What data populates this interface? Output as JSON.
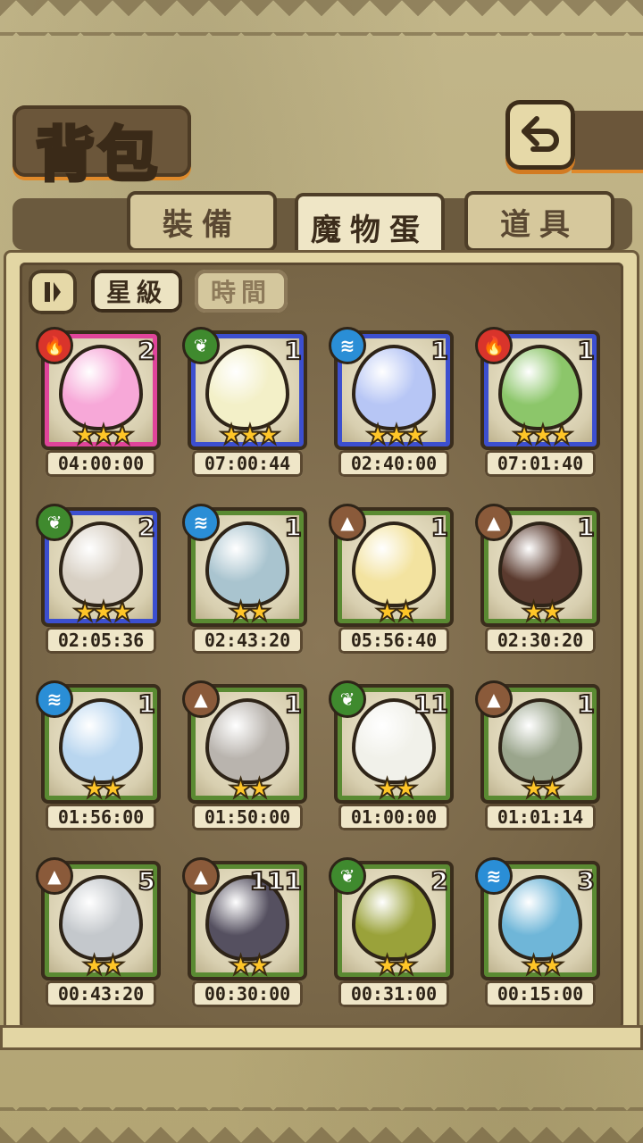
{
  "header": {
    "title": "背包"
  },
  "tabs": [
    {
      "label": "裝備",
      "active": false
    },
    {
      "label": "魔物蛋",
      "active": true
    },
    {
      "label": "道具",
      "active": false
    }
  ],
  "sort": {
    "star_label": "星級",
    "time_label": "時間"
  },
  "colors": {
    "fire": "#d9342b",
    "plant": "#3f8a2e",
    "water": "#2a8ed6",
    "earth": "#8a5a3a",
    "rarity_pink": "#e0449a",
    "rarity_blue": "#3c4fcf",
    "rarity_green": "#5a8a32"
  },
  "eggs": [
    {
      "element": "fire-icon",
      "count": "2",
      "stars": "★★★",
      "timer": "04:00:00",
      "rarity": "pink",
      "egg_color": "#f7a8d8"
    },
    {
      "element": "plant-icon",
      "count": "1",
      "stars": "★★★",
      "timer": "07:00:44",
      "rarity": "blue",
      "egg_color": "#f3f0c8"
    },
    {
      "element": "water-icon",
      "count": "1",
      "stars": "★★★",
      "timer": "02:40:00",
      "rarity": "blue",
      "egg_color": "#b7c6f5"
    },
    {
      "element": "fire-icon",
      "count": "1",
      "stars": "★★★",
      "timer": "07:01:40",
      "rarity": "blue",
      "egg_color": "#8cc66a"
    },
    {
      "element": "plant-icon",
      "count": "2",
      "stars": "★★★",
      "timer": "02:05:36",
      "rarity": "blue",
      "egg_color": "#d8d0c4"
    },
    {
      "element": "water-icon",
      "count": "1",
      "stars": "★★",
      "timer": "02:43:20",
      "rarity": "green",
      "egg_color": "#a9c4cf"
    },
    {
      "element": "earth-icon",
      "count": "1",
      "stars": "★★",
      "timer": "05:56:40",
      "rarity": "green",
      "egg_color": "#f3e3a0"
    },
    {
      "element": "earth-icon",
      "count": "1",
      "stars": "★★",
      "timer": "02:30:20",
      "rarity": "green",
      "egg_color": "#5a3a2e"
    },
    {
      "element": "water-icon",
      "count": "1",
      "stars": "★★",
      "timer": "01:56:00",
      "rarity": "green",
      "egg_color": "#b9d6ef"
    },
    {
      "element": "earth-icon",
      "count": "1",
      "stars": "★★",
      "timer": "01:50:00",
      "rarity": "green",
      "egg_color": "#b9b4ae"
    },
    {
      "element": "plant-icon",
      "count": "11",
      "stars": "★★",
      "timer": "01:00:00",
      "rarity": "green",
      "egg_color": "#f1f1ea"
    },
    {
      "element": "earth-icon",
      "count": "1",
      "stars": "★★",
      "timer": "01:01:14",
      "rarity": "green",
      "egg_color": "#9aa58c"
    },
    {
      "element": "earth-icon",
      "count": "5",
      "stars": "★★",
      "timer": "00:43:20",
      "rarity": "green",
      "egg_color": "#c4c8cc"
    },
    {
      "element": "earth-icon",
      "count": "111",
      "stars": "★★",
      "timer": "00:30:00",
      "rarity": "green",
      "egg_color": "#555060"
    },
    {
      "element": "plant-icon",
      "count": "2",
      "stars": "★★",
      "timer": "00:31:00",
      "rarity": "green",
      "egg_color": "#9aa23a"
    },
    {
      "element": "water-icon",
      "count": "3",
      "stars": "★★",
      "timer": "00:15:00",
      "rarity": "green",
      "egg_color": "#6fb6d8"
    }
  ]
}
